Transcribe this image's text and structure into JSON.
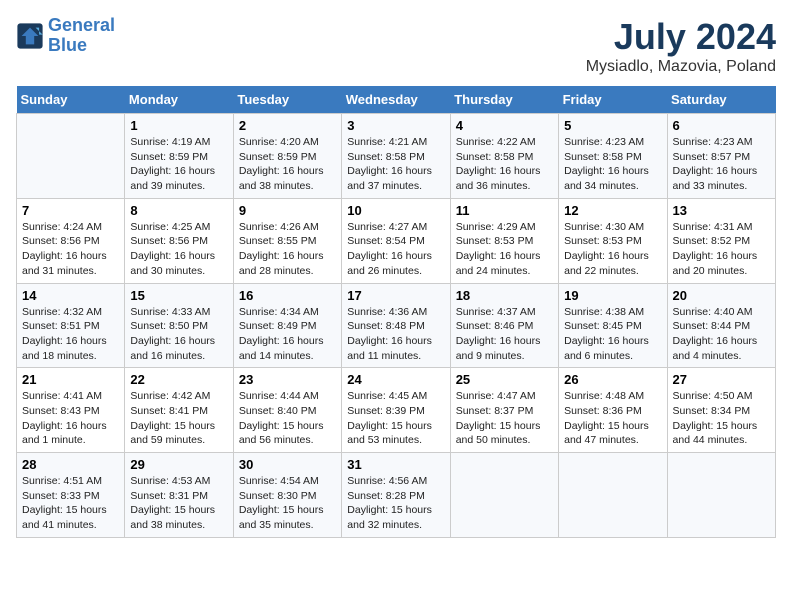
{
  "header": {
    "logo_line1": "General",
    "logo_line2": "Blue",
    "month": "July 2024",
    "location": "Mysiadlo, Mazovia, Poland"
  },
  "days_of_week": [
    "Sunday",
    "Monday",
    "Tuesday",
    "Wednesday",
    "Thursday",
    "Friday",
    "Saturday"
  ],
  "weeks": [
    [
      {
        "day": "",
        "info": ""
      },
      {
        "day": "1",
        "info": "Sunrise: 4:19 AM\nSunset: 8:59 PM\nDaylight: 16 hours\nand 39 minutes."
      },
      {
        "day": "2",
        "info": "Sunrise: 4:20 AM\nSunset: 8:59 PM\nDaylight: 16 hours\nand 38 minutes."
      },
      {
        "day": "3",
        "info": "Sunrise: 4:21 AM\nSunset: 8:58 PM\nDaylight: 16 hours\nand 37 minutes."
      },
      {
        "day": "4",
        "info": "Sunrise: 4:22 AM\nSunset: 8:58 PM\nDaylight: 16 hours\nand 36 minutes."
      },
      {
        "day": "5",
        "info": "Sunrise: 4:23 AM\nSunset: 8:58 PM\nDaylight: 16 hours\nand 34 minutes."
      },
      {
        "day": "6",
        "info": "Sunrise: 4:23 AM\nSunset: 8:57 PM\nDaylight: 16 hours\nand 33 minutes."
      }
    ],
    [
      {
        "day": "7",
        "info": "Sunrise: 4:24 AM\nSunset: 8:56 PM\nDaylight: 16 hours\nand 31 minutes."
      },
      {
        "day": "8",
        "info": "Sunrise: 4:25 AM\nSunset: 8:56 PM\nDaylight: 16 hours\nand 30 minutes."
      },
      {
        "day": "9",
        "info": "Sunrise: 4:26 AM\nSunset: 8:55 PM\nDaylight: 16 hours\nand 28 minutes."
      },
      {
        "day": "10",
        "info": "Sunrise: 4:27 AM\nSunset: 8:54 PM\nDaylight: 16 hours\nand 26 minutes."
      },
      {
        "day": "11",
        "info": "Sunrise: 4:29 AM\nSunset: 8:53 PM\nDaylight: 16 hours\nand 24 minutes."
      },
      {
        "day": "12",
        "info": "Sunrise: 4:30 AM\nSunset: 8:53 PM\nDaylight: 16 hours\nand 22 minutes."
      },
      {
        "day": "13",
        "info": "Sunrise: 4:31 AM\nSunset: 8:52 PM\nDaylight: 16 hours\nand 20 minutes."
      }
    ],
    [
      {
        "day": "14",
        "info": "Sunrise: 4:32 AM\nSunset: 8:51 PM\nDaylight: 16 hours\nand 18 minutes."
      },
      {
        "day": "15",
        "info": "Sunrise: 4:33 AM\nSunset: 8:50 PM\nDaylight: 16 hours\nand 16 minutes."
      },
      {
        "day": "16",
        "info": "Sunrise: 4:34 AM\nSunset: 8:49 PM\nDaylight: 16 hours\nand 14 minutes."
      },
      {
        "day": "17",
        "info": "Sunrise: 4:36 AM\nSunset: 8:48 PM\nDaylight: 16 hours\nand 11 minutes."
      },
      {
        "day": "18",
        "info": "Sunrise: 4:37 AM\nSunset: 8:46 PM\nDaylight: 16 hours\nand 9 minutes."
      },
      {
        "day": "19",
        "info": "Sunrise: 4:38 AM\nSunset: 8:45 PM\nDaylight: 16 hours\nand 6 minutes."
      },
      {
        "day": "20",
        "info": "Sunrise: 4:40 AM\nSunset: 8:44 PM\nDaylight: 16 hours\nand 4 minutes."
      }
    ],
    [
      {
        "day": "21",
        "info": "Sunrise: 4:41 AM\nSunset: 8:43 PM\nDaylight: 16 hours\nand 1 minute."
      },
      {
        "day": "22",
        "info": "Sunrise: 4:42 AM\nSunset: 8:41 PM\nDaylight: 15 hours\nand 59 minutes."
      },
      {
        "day": "23",
        "info": "Sunrise: 4:44 AM\nSunset: 8:40 PM\nDaylight: 15 hours\nand 56 minutes."
      },
      {
        "day": "24",
        "info": "Sunrise: 4:45 AM\nSunset: 8:39 PM\nDaylight: 15 hours\nand 53 minutes."
      },
      {
        "day": "25",
        "info": "Sunrise: 4:47 AM\nSunset: 8:37 PM\nDaylight: 15 hours\nand 50 minutes."
      },
      {
        "day": "26",
        "info": "Sunrise: 4:48 AM\nSunset: 8:36 PM\nDaylight: 15 hours\nand 47 minutes."
      },
      {
        "day": "27",
        "info": "Sunrise: 4:50 AM\nSunset: 8:34 PM\nDaylight: 15 hours\nand 44 minutes."
      }
    ],
    [
      {
        "day": "28",
        "info": "Sunrise: 4:51 AM\nSunset: 8:33 PM\nDaylight: 15 hours\nand 41 minutes."
      },
      {
        "day": "29",
        "info": "Sunrise: 4:53 AM\nSunset: 8:31 PM\nDaylight: 15 hours\nand 38 minutes."
      },
      {
        "day": "30",
        "info": "Sunrise: 4:54 AM\nSunset: 8:30 PM\nDaylight: 15 hours\nand 35 minutes."
      },
      {
        "day": "31",
        "info": "Sunrise: 4:56 AM\nSunset: 8:28 PM\nDaylight: 15 hours\nand 32 minutes."
      },
      {
        "day": "",
        "info": ""
      },
      {
        "day": "",
        "info": ""
      },
      {
        "day": "",
        "info": ""
      }
    ]
  ]
}
